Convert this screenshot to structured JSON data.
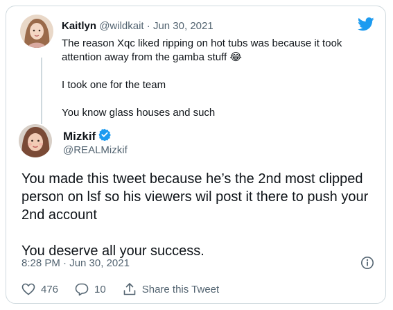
{
  "reply": {
    "name": "Kaitlyn",
    "handle": "@wildkait",
    "separator": "·",
    "date": "Jun 30, 2021",
    "line1": "The reason Xqc liked ripping on hot tubs was because it took attention away from the gamba stuff",
    "emoji": "😂",
    "line2": "I took one for the team",
    "line3": "You know glass houses and such"
  },
  "tweet": {
    "name": "Mizkif",
    "handle": "@REALMizkif",
    "verified": true,
    "text_para1": "You made this tweet because he’s the 2nd most clipped person on lsf so his viewers wil post it there to push your 2nd account",
    "text_para2": "You deserve all your success.",
    "timestamp": "8:28 PM · Jun 30, 2021"
  },
  "actions": {
    "likes": "476",
    "replies": "10",
    "share_label": "Share this Tweet"
  },
  "colors": {
    "brand": "#1d9bf0",
    "muted": "#536471",
    "border": "#cfd9de"
  }
}
